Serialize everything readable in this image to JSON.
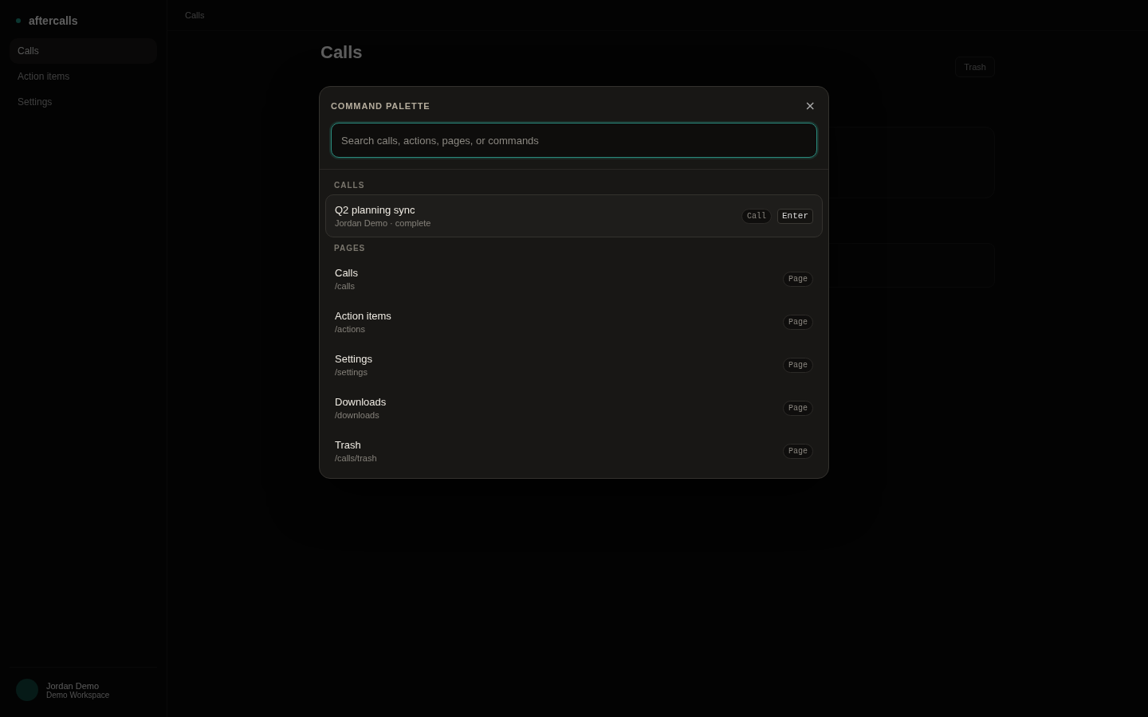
{
  "sidebar": {
    "brand": "aftercalls",
    "items": [
      {
        "label": "Calls",
        "selected": true
      },
      {
        "label": "Action items",
        "selected": false
      },
      {
        "label": "Settings",
        "selected": false
      }
    ],
    "user": {
      "name": "Jordan Demo",
      "workspace": "Demo Workspace"
    }
  },
  "main": {
    "breadcrumb": "Calls",
    "heading": "Calls",
    "trash_button": "Trash"
  },
  "palette": {
    "title": "COMMAND PALETTE",
    "close": "×",
    "search": {
      "placeholder": "Search calls, actions, pages, or commands"
    },
    "groups": [
      {
        "label": "CALLS",
        "items": [
          {
            "title": "Q2 planning sync",
            "subtitle": "Jordan Demo · complete",
            "tag": "Call",
            "shortcut": "Enter",
            "selected": true
          }
        ]
      },
      {
        "label": "PAGES",
        "items": [
          {
            "title": "Calls",
            "subtitle": "/calls",
            "tag": "Page",
            "selected": false
          },
          {
            "title": "Action items",
            "subtitle": "/actions",
            "tag": "Page",
            "selected": false
          },
          {
            "title": "Settings",
            "subtitle": "/settings",
            "tag": "Page",
            "selected": false
          },
          {
            "title": "Downloads",
            "subtitle": "/downloads",
            "tag": "Page",
            "selected": false
          },
          {
            "title": "Trash",
            "subtitle": "/calls/trash",
            "tag": "Page",
            "selected": false
          }
        ]
      }
    ]
  }
}
